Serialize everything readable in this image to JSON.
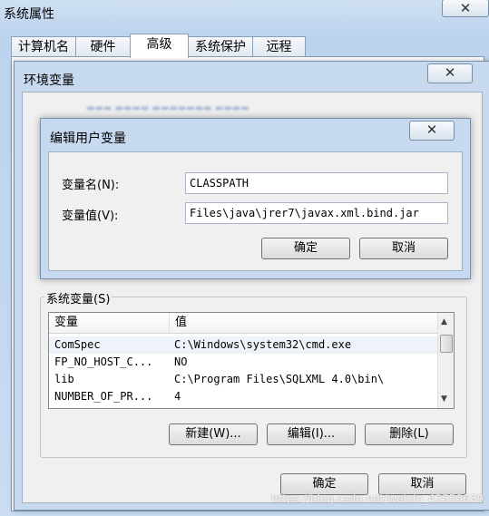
{
  "outer_window": {
    "title": "系统属性",
    "close_glyph": "✕",
    "tabs": [
      "计算机名",
      "硬件",
      "高级",
      "系统保护",
      "远程"
    ],
    "active_tab": "高级"
  },
  "env_dialog": {
    "title": "环境变量",
    "close_glyph": "✕",
    "system_vars": {
      "label": "系统变量(S)",
      "columns": [
        "变量",
        "值"
      ],
      "rows": [
        {
          "name": "ComSpec",
          "value": "C:\\Windows\\system32\\cmd.exe"
        },
        {
          "name": "FP_NO_HOST_C...",
          "value": "NO"
        },
        {
          "name": "lib",
          "value": "C:\\Program Files\\SQLXML 4.0\\bin\\"
        },
        {
          "name": "NUMBER_OF_PR...",
          "value": "4"
        }
      ],
      "buttons": {
        "new": "新建(W)...",
        "edit": "编辑(I)...",
        "delete": "删除(L)"
      }
    },
    "ok": "确定",
    "cancel": "取消"
  },
  "edit_dialog": {
    "title": "编辑用户变量",
    "close_glyph": "✕",
    "name_label": "变量名(N):",
    "name_value": "CLASSPATH",
    "value_label": "变量值(V):",
    "value_value": "Files\\java\\jrer7\\javax.xml.bind.jar",
    "ok": "确定",
    "cancel": "取消"
  },
  "watermark": "https://blog.csdn.net/weixin_43550639"
}
